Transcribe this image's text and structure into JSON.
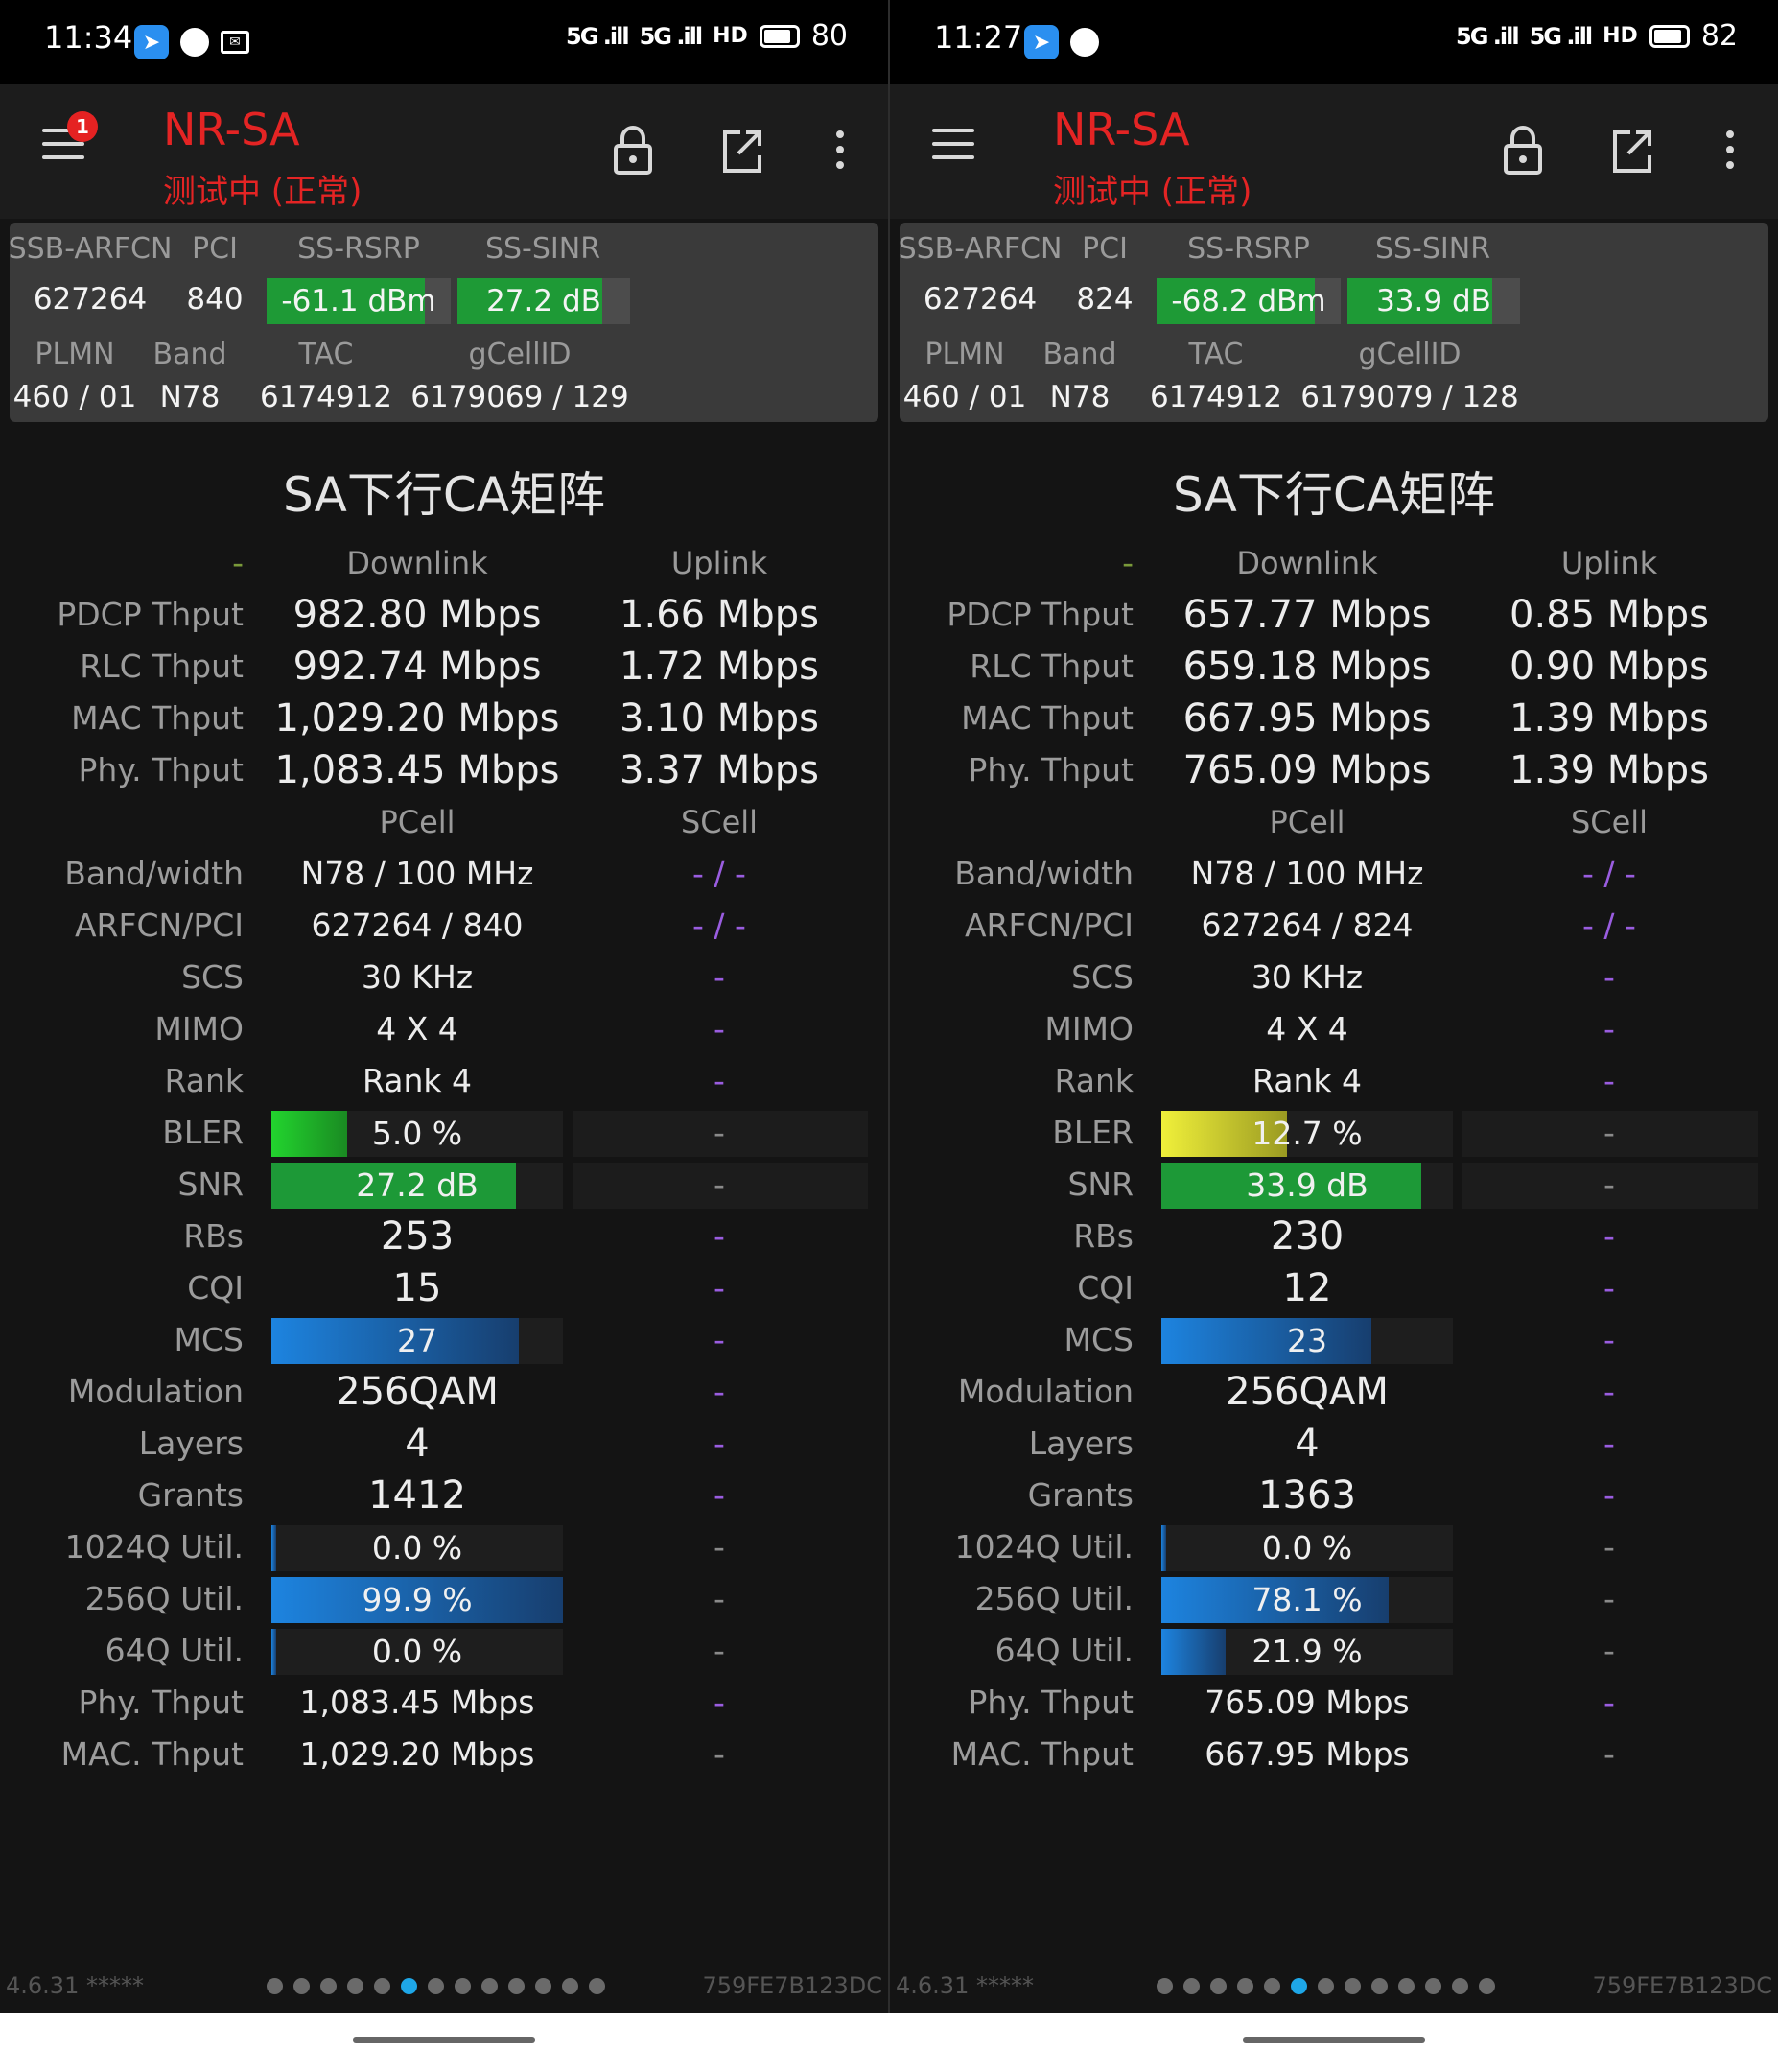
{
  "panels": [
    {
      "status": {
        "time": "11:34",
        "signal1": "5G .ill",
        "signal2": "5G .ill",
        "hd": "HD",
        "battery": "80",
        "battery_level": 0.8
      },
      "toolbar": {
        "badge": "1",
        "title": "NR-SA",
        "subtitle": "测试中 (正常)"
      },
      "card": {
        "h_arfcn": "SSB-ARFCN",
        "h_pci": "PCI",
        "h_rsrp": "SS-RSRP",
        "h_sinr": "SS-SINR",
        "arfcn": "627264",
        "pci": "840",
        "rsrp": "-61.1 dBm",
        "rsrp_level": 0.86,
        "sinr": "27.2 dB",
        "sinr_level": 0.84,
        "h_plmn": "PLMN",
        "h_band": "Band",
        "h_tac": "TAC",
        "h_gcell": "gCellID",
        "plmn": "460 / 01",
        "band": "N78",
        "tac": "6174912",
        "gcell": "6179069 / 129"
      },
      "section_title": "SA下行CA矩阵",
      "table": {
        "corner": "-",
        "h_downlink": "Downlink",
        "h_uplink": "Uplink",
        "pdcp_label": "PDCP Thput",
        "pdcp_dl": "982.80 Mbps",
        "pdcp_ul": "1.66 Mbps",
        "rlc_label": "RLC Thput",
        "rlc_dl": "992.74 Mbps",
        "rlc_ul": "1.72 Mbps",
        "mac_label": "MAC Thput",
        "mac_dl": "1,029.20 Mbps",
        "mac_ul": "3.10 Mbps",
        "phy_label": "Phy. Thput",
        "phy_dl": "1,083.45 Mbps",
        "phy_ul": "3.37 Mbps",
        "h_pcell": "PCell",
        "h_scell": "SCell",
        "bw_label": "Band/width",
        "bw_p": "N78 / 100 MHz",
        "bw_s": "- / -",
        "arfcnpci_label": "ARFCN/PCI",
        "arfcnpci_p": "627264 / 840",
        "arfcnpci_s": "- / -",
        "scs_label": "SCS",
        "scs_p": "30 KHz",
        "scs_s": "-",
        "mimo_label": "MIMO",
        "mimo_p": "4 X 4",
        "mimo_s": "-",
        "rank_label": "Rank",
        "rank_p": "Rank 4",
        "rank_s": "-",
        "bler_label": "BLER",
        "bler_p": "5.0 %",
        "bler_level": 0.26,
        "bler_s": "-",
        "snr_label": "SNR",
        "snr_p": "27.2 dB",
        "snr_level": 0.84,
        "snr_s": "-",
        "rbs_label": "RBs",
        "rbs_p": "253",
        "rbs_s": "-",
        "cqi_label": "CQI",
        "cqi_p": "15",
        "cqi_s": "-",
        "mcs_label": "MCS",
        "mcs_p": "27",
        "mcs_level": 0.85,
        "mcs_s": "-",
        "mod_label": "Modulation",
        "mod_p": "256QAM",
        "mod_s": "-",
        "layers_label": "Layers",
        "layers_p": "4",
        "layers_s": "-",
        "grants_label": "Grants",
        "grants_p": "1412",
        "grants_s": "-",
        "q1024_label": "1024Q Util.",
        "q1024_p": "0.0 %",
        "q1024_level": 0.0,
        "q1024_s": "-",
        "q256_label": "256Q Util.",
        "q256_p": "99.9 %",
        "q256_level": 0.999,
        "q256_s": "-",
        "q64_label": "64Q Util.",
        "q64_p": "0.0 %",
        "q64_level": 0.0,
        "q64_s": "-",
        "phy2_label": "Phy. Thput",
        "phy2_p": "1,083.45 Mbps",
        "phy2_s": "-",
        "mac2_label": "MAC. Thput",
        "mac2_p": "1,029.20 Mbps",
        "mac2_s": "-"
      },
      "footer": {
        "version": "4.6.31 *****",
        "device": "759FE7B123DC",
        "page_count": 13,
        "active_page": 5
      }
    },
    {
      "status": {
        "time": "11:27",
        "signal1": "5G .ill",
        "signal2": "5G .ill",
        "hd": "HD",
        "battery": "82",
        "battery_level": 0.82
      },
      "toolbar": {
        "badge": "",
        "title": "NR-SA",
        "subtitle": "测试中 (正常)"
      },
      "card": {
        "h_arfcn": "SSB-ARFCN",
        "h_pci": "PCI",
        "h_rsrp": "SS-RSRP",
        "h_sinr": "SS-SINR",
        "arfcn": "627264",
        "pci": "824",
        "rsrp": "-68.2 dBm",
        "rsrp_level": 0.86,
        "sinr": "33.9 dB",
        "sinr_level": 0.84,
        "h_plmn": "PLMN",
        "h_band": "Band",
        "h_tac": "TAC",
        "h_gcell": "gCellID",
        "plmn": "460 / 01",
        "band": "N78",
        "tac": "6174912",
        "gcell": "6179079 / 128"
      },
      "section_title": "SA下行CA矩阵",
      "table": {
        "corner": "-",
        "h_downlink": "Downlink",
        "h_uplink": "Uplink",
        "pdcp_label": "PDCP Thput",
        "pdcp_dl": "657.77 Mbps",
        "pdcp_ul": "0.85 Mbps",
        "rlc_label": "RLC Thput",
        "rlc_dl": "659.18 Mbps",
        "rlc_ul": "0.90 Mbps",
        "mac_label": "MAC Thput",
        "mac_dl": "667.95 Mbps",
        "mac_ul": "1.39 Mbps",
        "phy_label": "Phy. Thput",
        "phy_dl": "765.09 Mbps",
        "phy_ul": "1.39 Mbps",
        "h_pcell": "PCell",
        "h_scell": "SCell",
        "bw_label": "Band/width",
        "bw_p": "N78 / 100 MHz",
        "bw_s": "- / -",
        "arfcnpci_label": "ARFCN/PCI",
        "arfcnpci_p": "627264 / 824",
        "arfcnpci_s": "- / -",
        "scs_label": "SCS",
        "scs_p": "30 KHz",
        "scs_s": "-",
        "mimo_label": "MIMO",
        "mimo_p": "4 X 4",
        "mimo_s": "-",
        "rank_label": "Rank",
        "rank_p": "Rank 4",
        "rank_s": "-",
        "bler_label": "BLER",
        "bler_p": "12.7 %",
        "bler_level": 0.43,
        "bler_s": "-",
        "snr_label": "SNR",
        "snr_p": "33.9 dB",
        "snr_level": 0.89,
        "snr_s": "-",
        "rbs_label": "RBs",
        "rbs_p": "230",
        "rbs_s": "-",
        "cqi_label": "CQI",
        "cqi_p": "12",
        "cqi_s": "-",
        "mcs_label": "MCS",
        "mcs_p": "23",
        "mcs_level": 0.72,
        "mcs_s": "-",
        "mod_label": "Modulation",
        "mod_p": "256QAM",
        "mod_s": "-",
        "layers_label": "Layers",
        "layers_p": "4",
        "layers_s": "-",
        "grants_label": "Grants",
        "grants_p": "1363",
        "grants_s": "-",
        "q1024_label": "1024Q Util.",
        "q1024_p": "0.0 %",
        "q1024_level": 0.0,
        "q1024_s": "-",
        "q256_label": "256Q Util.",
        "q256_p": "78.1 %",
        "q256_level": 0.781,
        "q256_s": "-",
        "q64_label": "64Q Util.",
        "q64_p": "21.9 %",
        "q64_level": 0.219,
        "q64_s": "-",
        "phy2_label": "Phy. Thput",
        "phy2_p": "765.09 Mbps",
        "phy2_s": "-",
        "mac2_label": "MAC. Thput",
        "mac2_p": "667.95 Mbps",
        "mac2_s": "-"
      },
      "footer": {
        "version": "4.6.31 *****",
        "device": "759FE7B123DC",
        "page_count": 13,
        "active_page": 5
      }
    }
  ],
  "colors": {
    "accent_red": "#e42424",
    "good_green": "#1e9a36",
    "bar_blue": "#1d84e0",
    "warn_yellow": "#f0f03a",
    "page_dot_active": "#1ea7e8",
    "scell_dash": "#9a5de0"
  },
  "icons": {
    "menu": "menu-icon",
    "lock": "lock-icon",
    "external": "open-external-icon",
    "more": "more-vert-icon",
    "telegram": "telegram-icon",
    "mail": "mail-icon"
  }
}
